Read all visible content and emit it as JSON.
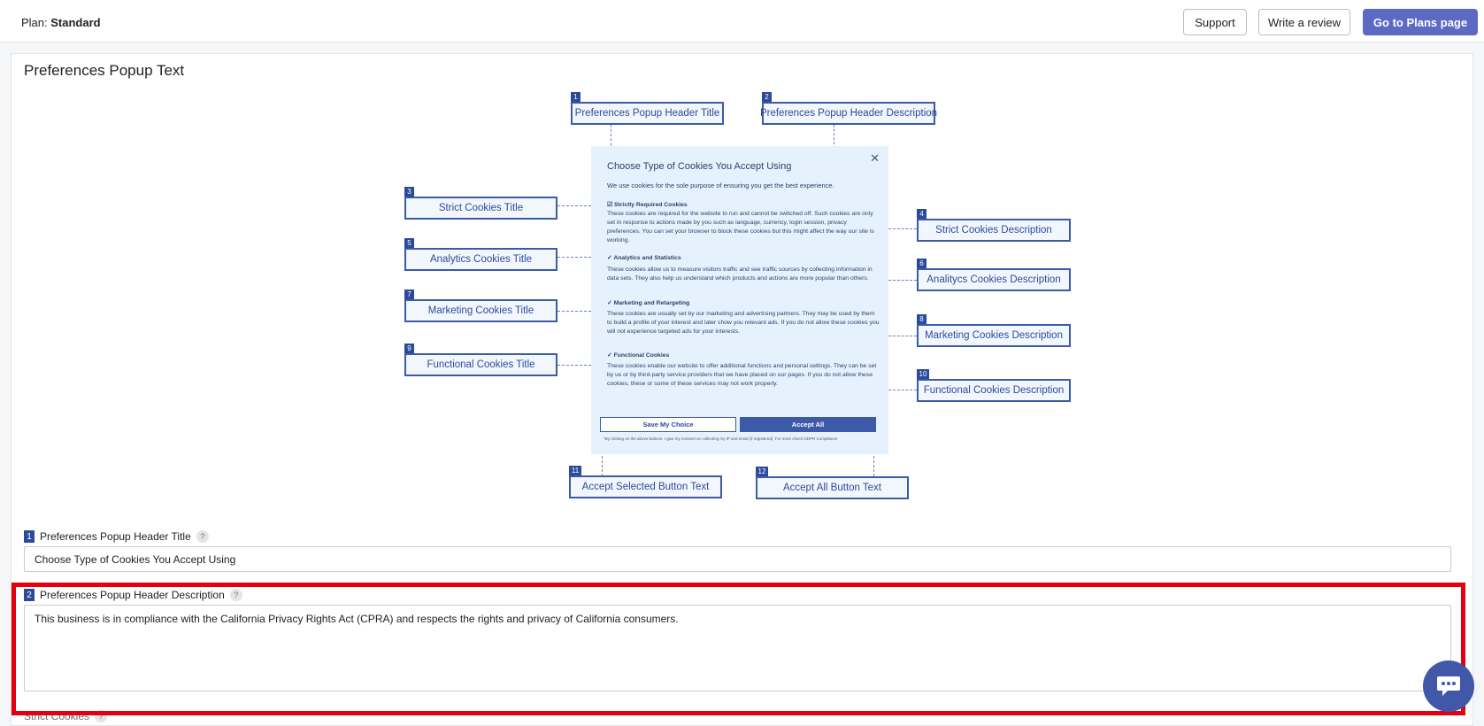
{
  "header": {
    "plan_prefix": "Plan:",
    "plan_name": "Standard",
    "support_label": "Support",
    "review_label": "Write a review",
    "plans_label": "Go to Plans page"
  },
  "section": {
    "title": "Preferences Popup Text"
  },
  "diagram": {
    "labels": [
      {
        "n": "1",
        "text": "Preferences Popup Header Title"
      },
      {
        "n": "2",
        "text": "Preferences Popup Header Description"
      },
      {
        "n": "3",
        "text": "Strict Cookies Title"
      },
      {
        "n": "4",
        "text": "Strict Cookies Description"
      },
      {
        "n": "5",
        "text": "Analytics Cookies Title"
      },
      {
        "n": "6",
        "text": "Analitycs Cookies Description"
      },
      {
        "n": "7",
        "text": "Marketing Cookies Title"
      },
      {
        "n": "8",
        "text": "Marketing Cookies Description"
      },
      {
        "n": "9",
        "text": "Functional Cookies Title"
      },
      {
        "n": "10",
        "text": "Functional Cookies Description"
      },
      {
        "n": "11",
        "text": "Accept Selected Button Text"
      },
      {
        "n": "12",
        "text": "Accept All Button Text"
      }
    ],
    "popup": {
      "title": "Choose Type of Cookies You Accept Using",
      "description": "We use cookies for the sole purpose of ensuring you get the best experience.",
      "sections": [
        {
          "title": "Strictly Required Cookies",
          "desc": "These cookies are required for the website to run and cannot be switched off. Such cookies are only set in response to actions made by you such as language, currency, login session, privacy preferences. You can set your browser to block these cookies but this might affect the way our site is working."
        },
        {
          "title": "Analytics and Statistics",
          "desc": "These cookies allow us to measure visitors traffic and see traffic sources by collecting information in data sets. They also help us understand which products and actions are more popular than others."
        },
        {
          "title": "Marketing and Retargeting",
          "desc": "These cookies are usually set by our marketing and advertising partners. They may be used by them to build a profile of your interest and later show you relevant ads. If you do not allow these cookies you will not experience targeted ads for your interests."
        },
        {
          "title": "Functional Cookies",
          "desc": "These cookies enable our website to offer additional functions and personal settings. They can be set by us or by third-party service providers that we have placed on our pages. If you do not allow these cookies, these or some of these services may not work properly."
        }
      ],
      "save_button": "Save My Choice",
      "accept_button": "Accept All",
      "note": "*By clicking on the above buttons, I give my consent on collecting my IP and email (if registered). For more check GDPR Compliance"
    }
  },
  "fields": {
    "header_title": {
      "num": "1",
      "label": "Preferences Popup Header Title",
      "value": "Choose Type of Cookies You Accept Using"
    },
    "header_description": {
      "num": "2",
      "label": "Preferences Popup Header Description",
      "value": "This business is in compliance with the California Privacy Rights Act (CPRA) and respects the rights and privacy of California consumers."
    },
    "strict_cookies_label": "Strict Cookies"
  },
  "help_glyph": "?",
  "colors": {
    "primary": "#5c6ac4",
    "diagram_blue": "#2c4a9a",
    "highlight": "#e3000f",
    "chat": "#4157a8"
  }
}
